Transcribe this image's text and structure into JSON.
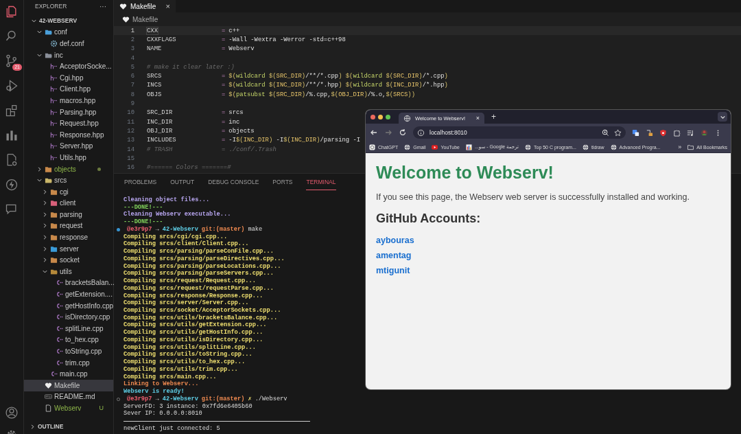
{
  "activity_bar": {
    "items": [
      {
        "kind": "explorer",
        "selected": true
      },
      {
        "kind": "search",
        "selected": false
      },
      {
        "kind": "source-control",
        "selected": false,
        "badge": "21"
      },
      {
        "kind": "run",
        "selected": false
      },
      {
        "kind": "extensions",
        "selected": false
      },
      {
        "kind": "chart",
        "selected": false
      },
      {
        "kind": "remote",
        "selected": false
      },
      {
        "kind": "bolt",
        "selected": false
      },
      {
        "kind": "chat",
        "selected": false
      }
    ],
    "bottom": [
      {
        "kind": "account"
      },
      {
        "kind": "settings"
      }
    ]
  },
  "sidebar": {
    "title": "EXPLORER",
    "more": "···",
    "tree": {
      "label": "42-WEBSERV",
      "kind": "root",
      "expanded": true,
      "selected": false,
      "children": [
        {
          "label": "conf",
          "kind": "folder",
          "color": "#4a9fd8",
          "expanded": true,
          "selected": false,
          "children": [
            {
              "label": "def.conf",
              "kind": "settings",
              "selected": false
            }
          ]
        },
        {
          "label": "inc",
          "kind": "folder",
          "color": "#8a8f99",
          "expanded": true,
          "selected": false,
          "children": [
            {
              "label": "AcceptorSocke...",
              "kind": "header",
              "selected": false
            },
            {
              "label": "Cgi.hpp",
              "kind": "header",
              "selected": false
            },
            {
              "label": "Client.hpp",
              "kind": "header",
              "selected": false
            },
            {
              "label": "macros.hpp",
              "kind": "header",
              "selected": false
            },
            {
              "label": "Parsing.hpp",
              "kind": "header",
              "selected": false
            },
            {
              "label": "Request.hpp",
              "kind": "header",
              "selected": false
            },
            {
              "label": "Response.hpp",
              "kind": "header",
              "selected": false
            },
            {
              "label": "Server.hpp",
              "kind": "header",
              "selected": false
            },
            {
              "label": "Utils.hpp",
              "kind": "header",
              "selected": false
            }
          ]
        },
        {
          "label": "objects",
          "kind": "folder",
          "color": "#c8894a",
          "expanded": false,
          "selected": false,
          "untracked": true,
          "dot": true
        },
        {
          "label": "srcs",
          "kind": "folder",
          "color": "#c9b66a",
          "expanded": true,
          "selected": false,
          "children": [
            {
              "label": "cgi",
              "kind": "folder",
              "color": "#c8894a",
              "expanded": false,
              "selected": false
            },
            {
              "label": "client",
              "kind": "folder",
              "color": "#d8607a",
              "expanded": false,
              "selected": false
            },
            {
              "label": "parsing",
              "kind": "folder",
              "color": "#c8894a",
              "expanded": false,
              "selected": false
            },
            {
              "label": "request",
              "kind": "folder",
              "color": "#c8894a",
              "expanded": false,
              "selected": false
            },
            {
              "label": "response",
              "kind": "folder",
              "color": "#c8894a",
              "expanded": false,
              "selected": false
            },
            {
              "label": "server",
              "kind": "folder",
              "color": "#3a9bd8",
              "expanded": false,
              "selected": false
            },
            {
              "label": "socket",
              "kind": "folder",
              "color": "#c8894a",
              "expanded": false,
              "selected": false
            },
            {
              "label": "utils",
              "kind": "folder",
              "color": "#b58a3a",
              "expanded": true,
              "selected": false,
              "children": [
                {
                  "label": "bracketsBalan...",
                  "kind": "source",
                  "selected": false
                },
                {
                  "label": "getExtension....",
                  "kind": "source",
                  "selected": false
                },
                {
                  "label": "getHostInfo.cpp",
                  "kind": "source",
                  "selected": false
                },
                {
                  "label": "isDirectory.cpp",
                  "kind": "source",
                  "selected": false
                },
                {
                  "label": "splitLine.cpp",
                  "kind": "source",
                  "selected": false
                },
                {
                  "label": "to_hex.cpp",
                  "kind": "source",
                  "selected": false
                },
                {
                  "label": "toString.cpp",
                  "kind": "source",
                  "selected": false
                },
                {
                  "label": "trim.cpp",
                  "kind": "source",
                  "selected": false
                }
              ]
            },
            {
              "label": "main.cpp",
              "kind": "source",
              "selected": false
            }
          ]
        },
        {
          "label": "Makefile",
          "kind": "makefile",
          "selected": true
        },
        {
          "label": "README.md",
          "kind": "markdown",
          "selected": false
        },
        {
          "label": "Webserv",
          "kind": "file",
          "selected": false,
          "untracked": true,
          "badge": "U"
        }
      ]
    },
    "outline": {
      "label": "OUTLINE",
      "expanded": false
    }
  },
  "editor": {
    "tabs": [
      {
        "label": "Makefile",
        "close": "×",
        "selected": true
      }
    ],
    "breadcrumb": "Makefile",
    "lines": [
      {
        "number": "1",
        "kind": "assign",
        "current": true,
        "name": "CXX",
        "op": "=",
        "value": "c++"
      },
      {
        "number": "2",
        "kind": "assign",
        "current": false,
        "name": "CXXFLAGS",
        "op": "=",
        "value": "-Wall -Wextra -Werror -std=c++98"
      },
      {
        "number": "3",
        "kind": "assign",
        "current": false,
        "name": "NAME",
        "op": "=",
        "value": "Webserv"
      },
      {
        "number": "4",
        "kind": "blank",
        "current": false
      },
      {
        "number": "5",
        "kind": "comment",
        "current": false,
        "text": "# make it clear later :)"
      },
      {
        "number": "6",
        "kind": "assign",
        "current": false,
        "name": "SRCS",
        "op": "=",
        "value": "$(wildcard $(SRC_DIR)/**/*.cpp) $(wildcard $(SRC_DIR)/*.cpp)"
      },
      {
        "number": "7",
        "kind": "assign",
        "current": false,
        "name": "INCS",
        "op": "=",
        "value": "$(wildcard $(INC_DIR)/**/*.hpp) $(wildcard $(INC_DIR)/*.hpp)"
      },
      {
        "number": "8",
        "kind": "assign",
        "current": false,
        "name": "OBJS",
        "op": "=",
        "value": "$(patsubst $(SRC_DIR)/%.cpp,$(OBJ_DIR)/%.o,$(SRCS))"
      },
      {
        "number": "9",
        "kind": "blank",
        "current": false
      },
      {
        "number": "10",
        "kind": "assign",
        "current": false,
        "name": "SRC_DIR",
        "op": "=",
        "value": "srcs"
      },
      {
        "number": "11",
        "kind": "assign",
        "current": false,
        "name": "INC_DIR",
        "op": "=",
        "value": "inc"
      },
      {
        "number": "12",
        "kind": "assign",
        "current": false,
        "name": "OBJ_DIR",
        "op": "=",
        "value": "objects"
      },
      {
        "number": "13",
        "kind": "assign",
        "current": false,
        "name": "INCLUDES",
        "op": "=",
        "value": "-I$(INC_DIR) -I$(INC_DIR)/parsing -I"
      },
      {
        "number": "14",
        "kind": "commented-assign",
        "current": false,
        "name": "# TRASH",
        "op": "=",
        "value": "./conf/.Trash"
      },
      {
        "number": "15",
        "kind": "blank",
        "current": false
      },
      {
        "number": "16",
        "kind": "comment",
        "current": false,
        "text": "#====== Colors =======#"
      }
    ]
  },
  "panel": {
    "tabs": [
      {
        "label": "PROBLEMS",
        "selected": false
      },
      {
        "label": "OUTPUT",
        "selected": false
      },
      {
        "label": "DEBUG CONSOLE",
        "selected": false
      },
      {
        "label": "PORTS",
        "selected": false
      },
      {
        "label": "TERMINAL",
        "selected": true
      }
    ],
    "terminal": [
      {
        "kind": "clean",
        "text": "Cleaning object files..."
      },
      {
        "kind": "done",
        "text": "---DONE!---"
      },
      {
        "kind": "clean",
        "text": "Cleaning Webserv executable..."
      },
      {
        "kind": "done",
        "text": "---DONE!---"
      },
      {
        "kind": "prompt",
        "finished": true,
        "user": "@e3r9p7",
        "arrow": "→",
        "dir": "42-Webserv",
        "branch": "git:(master)",
        "command": "make"
      },
      {
        "kind": "compile",
        "text": "Compiling srcs/cgi/cgi.cpp..."
      },
      {
        "kind": "compile",
        "text": "Compiling srcs/client/Client.cpp..."
      },
      {
        "kind": "compile",
        "text": "Compiling srcs/parsing/parseConFile.cpp..."
      },
      {
        "kind": "compile",
        "text": "Compiling srcs/parsing/parseDirectives.cpp..."
      },
      {
        "kind": "compile",
        "text": "Compiling srcs/parsing/parseLocations.cpp..."
      },
      {
        "kind": "compile",
        "text": "Compiling srcs/parsing/parseServers.cpp..."
      },
      {
        "kind": "compile",
        "text": "Compiling srcs/request/Request.cpp..."
      },
      {
        "kind": "compile",
        "text": "Compiling srcs/request/requestParse.cpp..."
      },
      {
        "kind": "compile",
        "text": "Compiling srcs/response/Response.cpp..."
      },
      {
        "kind": "compile",
        "text": "Compiling srcs/server/Server.cpp..."
      },
      {
        "kind": "compile",
        "text": "Compiling srcs/socket/AcceptorSockets.cpp..."
      },
      {
        "kind": "compile",
        "text": "Compiling srcs/utils/bracketsBalance.cpp..."
      },
      {
        "kind": "compile",
        "text": "Compiling srcs/utils/getExtension.cpp..."
      },
      {
        "kind": "compile",
        "text": "Compiling srcs/utils/getHostInfo.cpp..."
      },
      {
        "kind": "compile",
        "text": "Compiling srcs/utils/isDirectory.cpp..."
      },
      {
        "kind": "compile",
        "text": "Compiling srcs/utils/splitLine.cpp..."
      },
      {
        "kind": "compile",
        "text": "Compiling srcs/utils/toString.cpp..."
      },
      {
        "kind": "compile",
        "text": "Compiling srcs/utils/to_hex.cpp..."
      },
      {
        "kind": "compile",
        "text": "Compiling srcs/utils/trim.cpp..."
      },
      {
        "kind": "compile",
        "text": "Compiling srcs/main.cpp..."
      },
      {
        "kind": "link",
        "text": "Linking to Webserv..."
      },
      {
        "kind": "ready",
        "text": "Webserv is ready!"
      },
      {
        "kind": "prompt",
        "finished": false,
        "user": "@e3r9p7",
        "arrow": "→",
        "dir": "42-Webserv",
        "branch": "git:(master)",
        "dirty": "✗",
        "command": "./Webserv"
      },
      {
        "kind": "output",
        "text": "ServerFD: 3 instance: 0x7fd6e6405b60"
      },
      {
        "kind": "output",
        "text": "Sever IP: 0.0.0.0:8010"
      },
      {
        "kind": "rule"
      },
      {
        "kind": "output",
        "text": "newClient just connected: 5"
      }
    ]
  },
  "browser": {
    "tab": {
      "title": "Welcome to Webserv!",
      "close": "×"
    },
    "new_tab": "+",
    "nav": [
      {
        "kind": "back",
        "disabled": false
      },
      {
        "kind": "forward",
        "disabled": true
      },
      {
        "kind": "reload",
        "disabled": false
      }
    ],
    "url": "localhost:8010",
    "bookmarks": [
      {
        "label": "ChatGPT",
        "kind": "app"
      },
      {
        "label": "Gmail",
        "kind": "globe"
      },
      {
        "label": "YouTube",
        "kind": "video"
      },
      {
        "label": "ترجمة Google - سو...",
        "kind": "translate"
      },
      {
        "label": "Top 50 C program...",
        "kind": "globe"
      },
      {
        "label": "tldraw",
        "kind": "globe"
      },
      {
        "label": "Advanced Progra...",
        "kind": "globe"
      }
    ],
    "overflow": "»",
    "all_bookmarks": "All Bookmarks",
    "page": {
      "heading": "Welcome to Webserv!",
      "text": "If you see this page, the Webserv web server is successfully installed and working.",
      "subheading": "GitHub Accounts:",
      "links": [
        "aybouras",
        "amentag",
        "mtigunit"
      ]
    }
  }
}
